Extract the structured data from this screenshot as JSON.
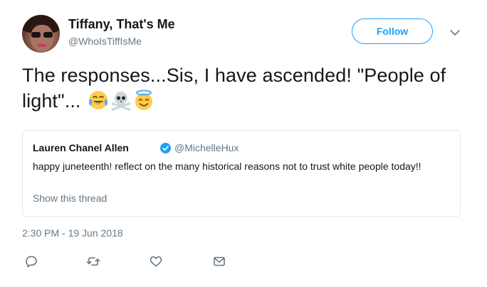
{
  "user": {
    "name": "Tiffany, That's Me",
    "handle": "@WhoIsTiffIsMe"
  },
  "follow_button": {
    "label": "Follow"
  },
  "icons": {
    "caret": "chevron-down-icon",
    "verified": "verified-badge-icon",
    "reply": "reply-icon",
    "retweet": "retweet-icon",
    "like": "heart-icon",
    "message": "direct-message-icon"
  },
  "tweet": {
    "text": "The responses...Sis, I have ascended! \"People of light\"...",
    "emojis": [
      "tears-of-joy-emoji",
      "skull-crossbones-emoji",
      "smiling-halo-emoji"
    ],
    "timestamp": "2:30 PM - 19 Jun 2018"
  },
  "quoted_tweet": {
    "name": "Lauren Chanel Allen",
    "handle": "@MichelleHux",
    "text": "happy juneteenth! reflect on the many historical reasons not to trust white people today!!",
    "show_thread": "Show this thread"
  },
  "colors": {
    "accent": "#1da1f2",
    "secondary_text": "#657786",
    "primary_text": "#14171a",
    "border": "#e1e8ed"
  }
}
